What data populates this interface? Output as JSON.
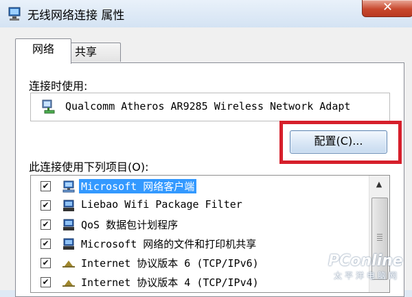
{
  "window": {
    "title": "无线网络连接 属性",
    "close_label": "✕"
  },
  "tabs": [
    {
      "label": "网络",
      "active": true
    },
    {
      "label": "共享",
      "active": false
    }
  ],
  "connect_using": {
    "label": "连接时使用:",
    "adapter_name": "Qualcomm Atheros AR9285 Wireless Network Adapt"
  },
  "configure_button": {
    "label": "配置(C)..."
  },
  "items": {
    "label": "此连接使用下列项目(O):",
    "rows": [
      {
        "label": "Microsoft 网络客户端",
        "checked": true,
        "icon": "network-client-icon",
        "selected": true
      },
      {
        "label": "Liebao Wifi Package Filter",
        "checked": true,
        "icon": "network-service-icon",
        "selected": false
      },
      {
        "label": "QoS 数据包计划程序",
        "checked": true,
        "icon": "network-service-icon",
        "selected": false
      },
      {
        "label": "Microsoft 网络的文件和打印机共享",
        "checked": true,
        "icon": "network-service-icon",
        "selected": false
      },
      {
        "label": "Internet 协议版本 6 (TCP/IPv6)",
        "checked": true,
        "icon": "protocol-icon",
        "selected": false
      },
      {
        "label": "Internet 协议版本 4 (TCP/IPv4)",
        "checked": true,
        "icon": "protocol-icon",
        "selected": false
      }
    ],
    "check_glyph": "✔",
    "scroll_up_glyph": "▲"
  },
  "watermark": {
    "brand": "PConline",
    "sub": "太平洋电脑网"
  },
  "colors": {
    "highlight": "#d61f2b",
    "selection": "#3399ff"
  }
}
